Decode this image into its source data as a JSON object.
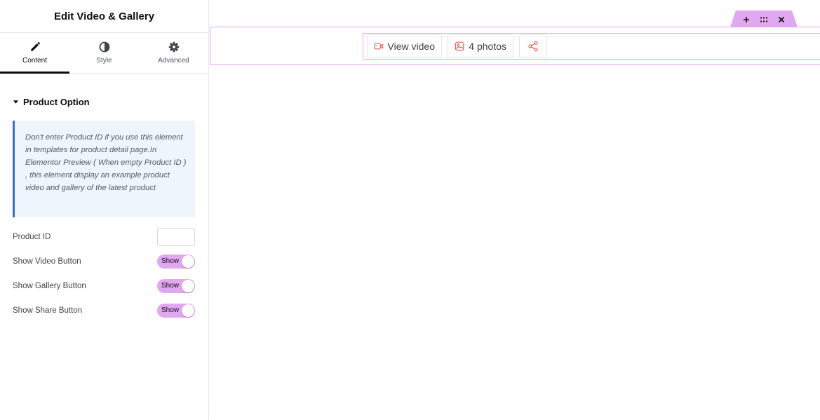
{
  "panel": {
    "title": "Edit Video & Gallery",
    "tabs": [
      {
        "label": "Content",
        "icon": "pencil-icon",
        "active": true
      },
      {
        "label": "Style",
        "icon": "half-circle-icon",
        "active": false
      },
      {
        "label": "Advanced",
        "icon": "gear-icon",
        "active": false
      }
    ],
    "section": {
      "title": "Product Option",
      "notice": "Don't enter Product ID if you use this element in templates for product detail page.In Elementor Preview ( When empty Product ID ) , this element display an example product video and gallery of the latest product",
      "fields": {
        "product_id": {
          "label": "Product ID",
          "value": "",
          "placeholder": ""
        },
        "show_video": {
          "label": "Show Video Button",
          "state": "Show"
        },
        "show_gallery": {
          "label": "Show Gallery Button",
          "state": "Show"
        },
        "show_share": {
          "label": "Show Share Button",
          "state": "Show"
        }
      }
    }
  },
  "preview": {
    "buttons": [
      {
        "label": "View video",
        "icon": "video-camera-icon"
      },
      {
        "label": "4 photos",
        "icon": "image-icon"
      },
      {
        "label": "",
        "icon": "share-icon"
      }
    ],
    "handle_icons": [
      "plus-icon",
      "drag-grid-icon",
      "close-icon"
    ]
  },
  "colors": {
    "accent_pink": "#e1a7f1",
    "outline_pink": "#e0a5f0",
    "icon_red": "#e85a5a",
    "notice_bg": "#eef5fd",
    "notice_border": "#3a6bd1"
  }
}
